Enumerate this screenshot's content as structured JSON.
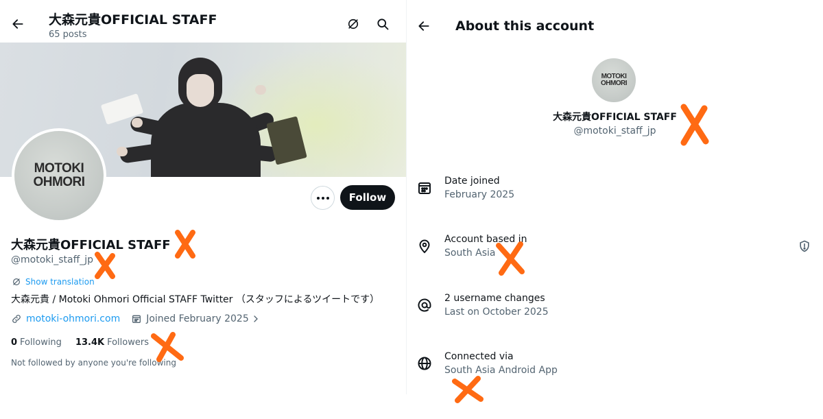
{
  "profile": {
    "header_title": "大森元貴OFFICIAL STAFF",
    "posts_count": "65 posts",
    "avatar_text_line1": "MOTOKI",
    "avatar_text_line2": "OHMORI",
    "display_name": "大森元貴OFFICIAL STAFF",
    "handle": "@motoki_staff_jp",
    "show_translation": "Show translation",
    "bio": "大森元貴 / Motoki Ohmori Official STAFF Twitter （スタッフによるツイートです）",
    "website": "motoki-ohmori.com",
    "joined": "Joined February 2025",
    "following_count": "0",
    "following_label": "Following",
    "followers_count": "13.4K",
    "followers_label": "Followers",
    "not_followed": "Not followed by anyone you're following",
    "follow_button": "Follow"
  },
  "about": {
    "title": "About this account",
    "display_name": "大森元貴OFFICIAL STAFF",
    "handle": "@motoki_staff_jp",
    "rows": [
      {
        "label": "Date joined",
        "value": "February 2025",
        "icon": "calendar-icon"
      },
      {
        "label": "Account based in",
        "value": "South Asia",
        "icon": "location-pin-icon"
      },
      {
        "label": "2 username changes",
        "value": "Last on October 2025",
        "icon": "at-sign-icon"
      },
      {
        "label": "Connected via",
        "value": "South Asia Android App",
        "icon": "globe-icon"
      }
    ]
  },
  "colors": {
    "link": "#1d9bf0",
    "secondary_text": "#536471",
    "primary_text": "#0f1419",
    "redaction_mark": "#ff6a13"
  }
}
